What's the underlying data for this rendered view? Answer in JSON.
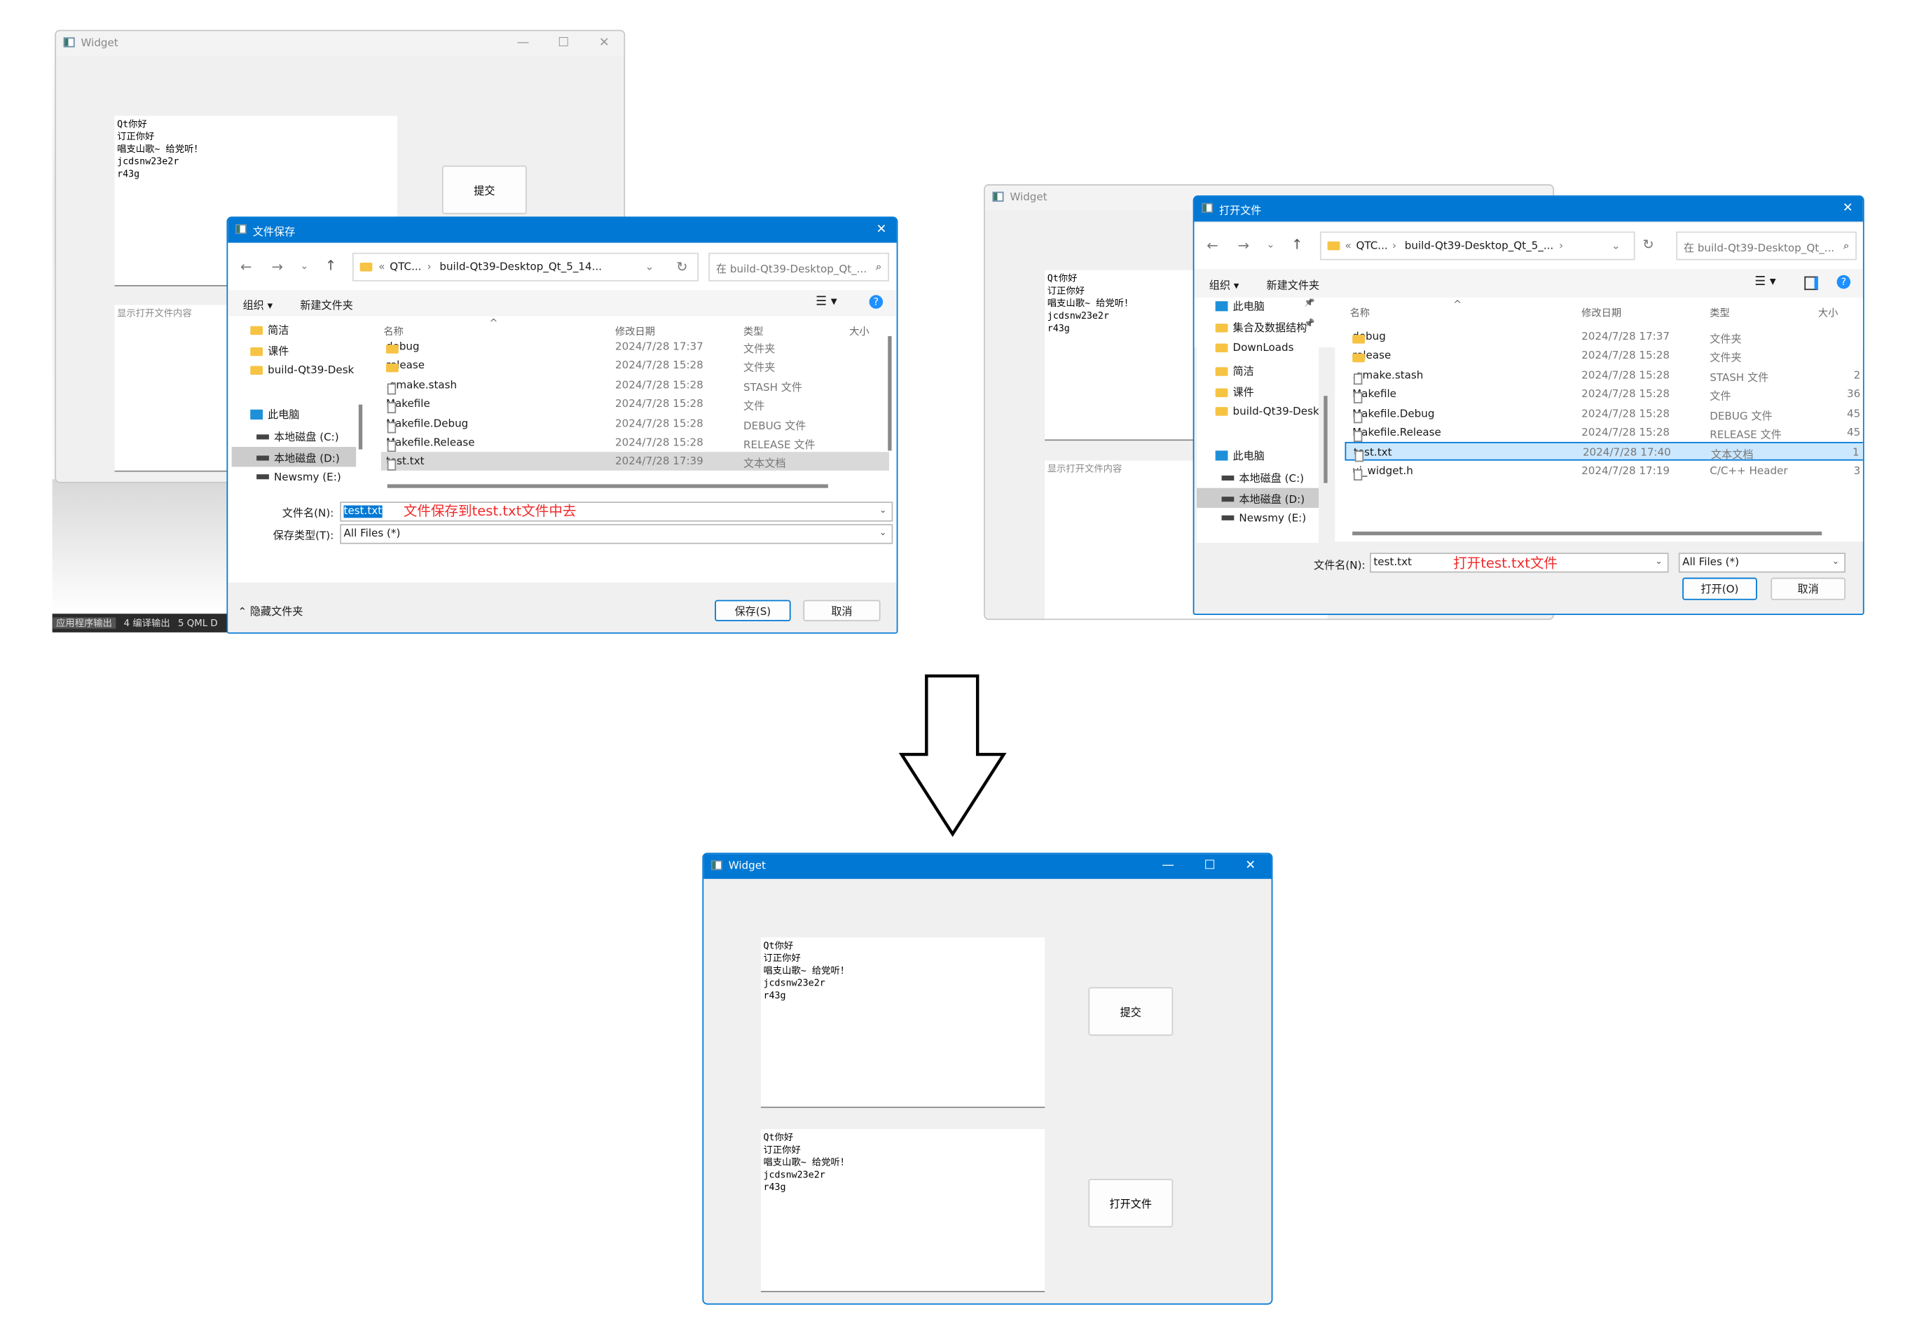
{
  "widget_text_lines": "Qt你好\n订正你好\n唱支山歌~ 给党听！\njcdsnw23e2r\nr43g",
  "colors": {
    "accent": "#0078d4",
    "annotation": "#f02a2a",
    "selected_row_blue": "#cce8ff"
  },
  "left_widget": {
    "title": "Widget",
    "submit_button": "提交",
    "placeholder": "显示打开文件内容"
  },
  "ide_bottom_bar": {
    "items": [
      "应用程序输出",
      "4 编译输出",
      "5 QML D"
    ]
  },
  "save_dialog": {
    "title": "文件保存",
    "breadcrumb": [
      "«",
      "QTC...",
      "›",
      "build-Qt39-Desktop_Qt_5_14..."
    ],
    "search_placeholder": "在 build-Qt39-Desktop_Qt_...",
    "organize": "组织 ▾",
    "new_folder": "新建文件夹",
    "sidebar": [
      {
        "label": "简洁",
        "icon": "folder"
      },
      {
        "label": "课件",
        "icon": "folder"
      },
      {
        "label": "build-Qt39-Desk",
        "icon": "folder"
      },
      {
        "label": "此电脑",
        "icon": "pc"
      },
      {
        "label": "本地磁盘 (C:)",
        "icon": "drive"
      },
      {
        "label": "本地磁盘 (D:)",
        "icon": "drive",
        "selected": true
      },
      {
        "label": "Newsmy (E:)",
        "icon": "drive"
      }
    ],
    "columns": [
      "名称",
      "修改日期",
      "类型",
      "大小"
    ],
    "files": [
      {
        "name": "debug",
        "date": "2024/7/28 17:37",
        "type": "文件夹",
        "size": "",
        "icon": "folder"
      },
      {
        "name": "release",
        "date": "2024/7/28 15:28",
        "type": "文件夹",
        "size": "",
        "icon": "folder"
      },
      {
        "name": ".qmake.stash",
        "date": "2024/7/28 15:28",
        "type": "STASH 文件",
        "size": "",
        "icon": "file"
      },
      {
        "name": "Makefile",
        "date": "2024/7/28 15:28",
        "type": "文件",
        "size": "",
        "icon": "file"
      },
      {
        "name": "Makefile.Debug",
        "date": "2024/7/28 15:28",
        "type": "DEBUG 文件",
        "size": "",
        "icon": "file"
      },
      {
        "name": "Makefile.Release",
        "date": "2024/7/28 15:28",
        "type": "RELEASE 文件",
        "size": "",
        "icon": "file"
      },
      {
        "name": "test.txt",
        "date": "2024/7/28 17:39",
        "type": "文本文档",
        "size": "",
        "icon": "file",
        "selected": true
      }
    ],
    "filename_label": "文件名(N):",
    "filename_value": "test.txt",
    "filetype_label": "保存类型(T):",
    "filetype_value": "All Files  (*)",
    "hide_folders": "隐藏文件夹",
    "save_button": "保存(S)",
    "cancel_button": "取消",
    "annotation": "文件保存到test.txt文件中去"
  },
  "right_widget": {
    "title": "Widget",
    "placeholder": "显示打开文件内容"
  },
  "open_dialog": {
    "title": "打开文件",
    "breadcrumb": [
      "«",
      "QTC...",
      "›",
      "build-Qt39-Desktop_Qt_5_...",
      "›"
    ],
    "search_placeholder": "在 build-Qt39-Desktop_Qt_...",
    "organize": "组织 ▾",
    "new_folder": "新建文件夹",
    "sidebar": [
      {
        "label": "此电脑",
        "icon": "pc",
        "pinned": true
      },
      {
        "label": "集合及数据结构",
        "icon": "folder",
        "pinned": true
      },
      {
        "label": "DownLoads",
        "icon": "folder"
      },
      {
        "label": "简洁",
        "icon": "folder"
      },
      {
        "label": "课件",
        "icon": "folder"
      },
      {
        "label": "build-Qt39-Desk",
        "icon": "folder"
      },
      {
        "label": "此电脑",
        "icon": "pc"
      },
      {
        "label": "本地磁盘 (C:)",
        "icon": "drive"
      },
      {
        "label": "本地磁盘 (D:)",
        "icon": "drive",
        "selected": true
      },
      {
        "label": "Newsmy (E:)",
        "icon": "drive"
      }
    ],
    "columns": [
      "名称",
      "修改日期",
      "类型",
      "大小"
    ],
    "files": [
      {
        "name": "debug",
        "date": "2024/7/28 17:37",
        "type": "文件夹",
        "size": "",
        "icon": "folder"
      },
      {
        "name": "release",
        "date": "2024/7/28 15:28",
        "type": "文件夹",
        "size": "",
        "icon": "folder"
      },
      {
        "name": ".qmake.stash",
        "date": "2024/7/28 15:28",
        "type": "STASH 文件",
        "size": "2",
        "icon": "file"
      },
      {
        "name": "Makefile",
        "date": "2024/7/28 15:28",
        "type": "文件",
        "size": "36",
        "icon": "file"
      },
      {
        "name": "Makefile.Debug",
        "date": "2024/7/28 15:28",
        "type": "DEBUG 文件",
        "size": "45",
        "icon": "file"
      },
      {
        "name": "Makefile.Release",
        "date": "2024/7/28 15:28",
        "type": "RELEASE 文件",
        "size": "45",
        "icon": "file"
      },
      {
        "name": "test.txt",
        "date": "2024/7/28 17:40",
        "type": "文本文档",
        "size": "1",
        "icon": "file",
        "selected": true
      },
      {
        "name": "ui_widget.h",
        "date": "2024/7/28 17:19",
        "type": "C/C++ Header",
        "size": "3",
        "icon": "file"
      }
    ],
    "filename_label": "文件名(N):",
    "filename_value": "test.txt",
    "filetype_value": "All Files  (*)",
    "open_button": "打开(O)",
    "cancel_button": "取消",
    "annotation": "打开test.txt文件"
  },
  "result_widget": {
    "title": "Widget",
    "submit_button": "提交",
    "open_file_button": "打开文件"
  }
}
